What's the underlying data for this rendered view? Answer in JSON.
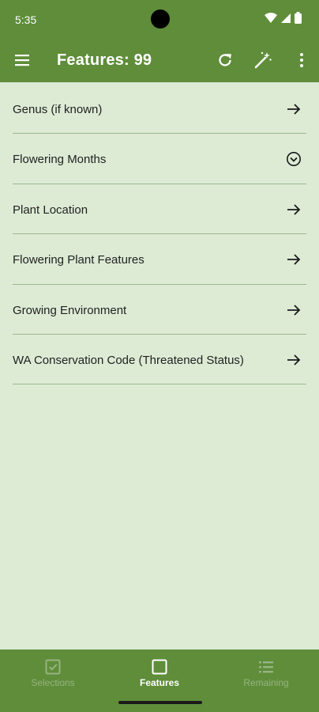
{
  "status_bar": {
    "time": "5:35"
  },
  "app_bar": {
    "title": "Features: 99"
  },
  "list": [
    {
      "label": "Genus (if known)",
      "icon": "arrow-right-icon"
    },
    {
      "label": "Flowering Months",
      "icon": "chevron-down-circle-icon"
    },
    {
      "label": "Plant Location",
      "icon": "arrow-right-icon"
    },
    {
      "label": "Flowering Plant Features",
      "icon": "arrow-right-icon"
    },
    {
      "label": "Growing Environment",
      "icon": "arrow-right-icon"
    },
    {
      "label": "WA Conservation Code (Threatened Status)",
      "icon": "arrow-right-icon"
    }
  ],
  "bottom_nav": [
    {
      "label": "Selections",
      "icon": "checkbox-icon",
      "active": false
    },
    {
      "label": "Features",
      "icon": "square-icon",
      "active": true
    },
    {
      "label": "Remaining",
      "icon": "list-icon",
      "active": false
    }
  ],
  "colors": {
    "primary": "#5f8d3a",
    "background": "#ddebd5",
    "divider": "#9cb88a",
    "inactive_nav": "#97b481"
  }
}
